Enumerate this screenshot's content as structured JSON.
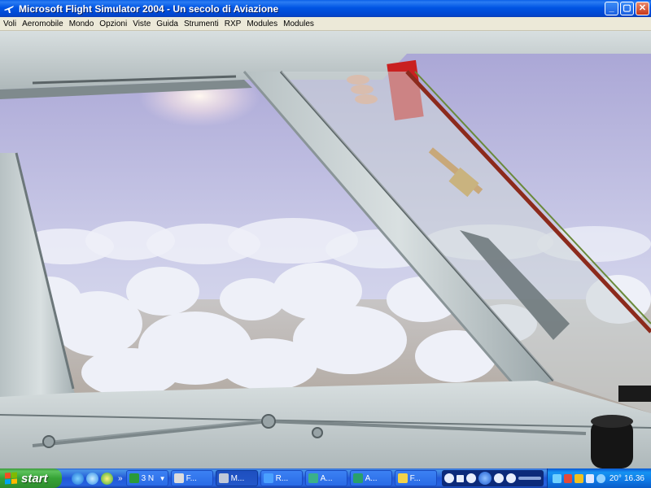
{
  "window": {
    "title": "Microsoft Flight Simulator 2004 - Un secolo di Aviazione",
    "icon": "plane-app-icon",
    "controls": [
      "minimize",
      "maximize",
      "close"
    ]
  },
  "menu": [
    "Voli",
    "Aeromobile",
    "Mondo",
    "Opzioni",
    "Viste",
    "Guida",
    "Strumenti",
    "RXP",
    "Modules",
    "Modules"
  ],
  "scene": {
    "description_icons": [
      "cockpit-window-frame",
      "cloud-layer",
      "sun-glare"
    ],
    "colors": {
      "sky_top": "#a9a5d6",
      "sky_horizon": "#d8dcef",
      "cloud": "#eef0f8",
      "frame": "#c9d2d3",
      "frame_dark": "#7e898c",
      "red_panel": "#c92020"
    }
  },
  "taskbar": {
    "start_label": "start",
    "quicklaunch_more": "»",
    "tasks": [
      {
        "label": "3 N",
        "icon": "excel-icon",
        "color": "#2a9a3a",
        "dropdown": true,
        "active": false
      },
      {
        "label": "F...",
        "icon": "window-icon",
        "color": "#dcdcdc",
        "dropdown": false,
        "active": false
      },
      {
        "label": "M...",
        "icon": "plane-icon",
        "color": "#c0c8d8",
        "dropdown": false,
        "active": true
      },
      {
        "label": "R...",
        "icon": "ie-icon",
        "color": "#4aa0ff",
        "dropdown": false,
        "active": false
      },
      {
        "label": "A...",
        "icon": "app-icon",
        "color": "#3ab08a",
        "dropdown": false,
        "active": false
      },
      {
        "label": "A...",
        "icon": "app-icon",
        "color": "#2aa06a",
        "dropdown": false,
        "active": false
      },
      {
        "label": "F...",
        "icon": "folder-icon",
        "color": "#f2d24a",
        "dropdown": false,
        "active": false
      }
    ],
    "tray": {
      "temperature": "20°",
      "clock": "16.36"
    }
  }
}
